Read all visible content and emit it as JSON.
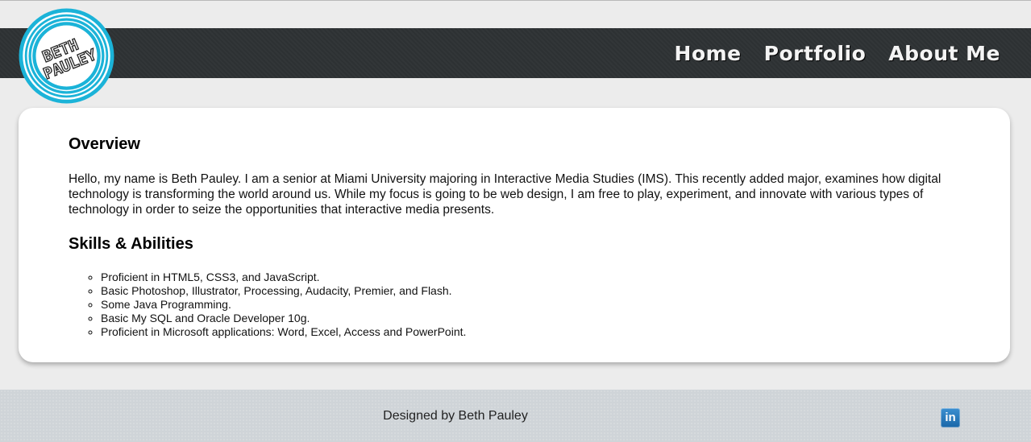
{
  "logo": {
    "line1": "BETH",
    "line2": "PAULEY"
  },
  "nav": {
    "items": [
      {
        "label": "Home"
      },
      {
        "label": "Portfolio"
      },
      {
        "label": "About Me"
      }
    ]
  },
  "overview": {
    "title": "Overview",
    "body": "Hello, my name is Beth Pauley. I am a senior at Miami University majoring in Interactive Media Studies (IMS). This recently added major, examines how digital technology is transforming the world around us. While my focus is going to be web design, I am free to play, experiment, and innovate with various types of technology in order to seize the opportunities that interactive media presents."
  },
  "skills": {
    "title": "Skills & Abilities",
    "items": [
      "Proficient in HTML5, CSS3, and JavaScript.",
      "Basic Photoshop, Illustrator, Processing, Audacity, Premier, and Flash.",
      "Some Java Programming.",
      "Basic My SQL and Oracle Developer 10g.",
      "Proficient in Microsoft applications: Word, Excel, Access and PowerPoint."
    ]
  },
  "footer": {
    "credit": "Designed by Beth Pauley",
    "linkedin_icon": "in"
  },
  "colors": {
    "page_bg": "#ececec",
    "header_bg": "#2e3234",
    "logo_ring": "#1bb3d8",
    "card_bg": "#ffffff",
    "footer_bg": "#cfd4d8",
    "linkedin_blue": "#1a67a8"
  }
}
